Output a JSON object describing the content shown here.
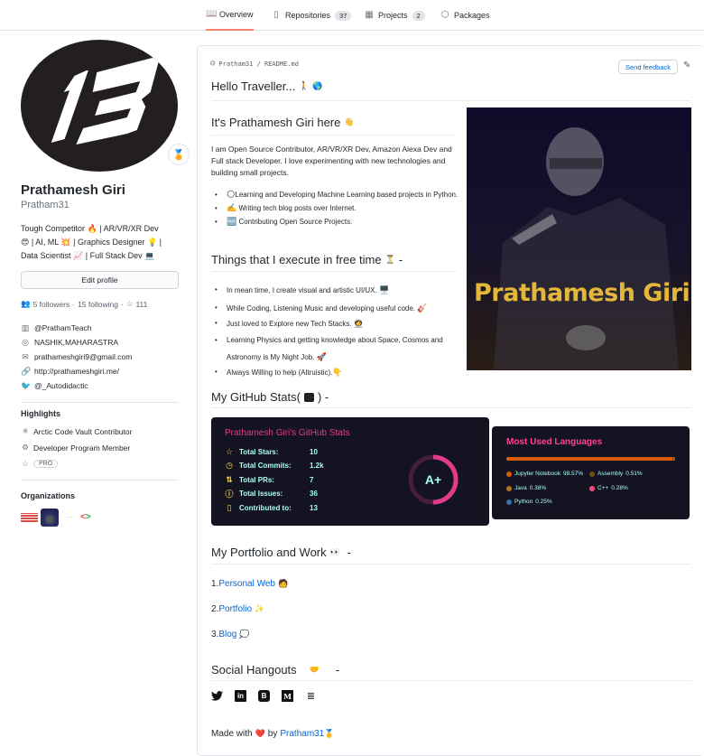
{
  "tabs": [
    {
      "label": "Overview",
      "icon": "book-icon",
      "active": true
    },
    {
      "label": "Repositories",
      "icon": "repo-icon",
      "count": "37"
    },
    {
      "label": "Projects",
      "icon": "project-icon",
      "count": "2"
    },
    {
      "label": "Packages",
      "icon": "package-icon"
    }
  ],
  "profile": {
    "full_name": "Prathamesh Giri",
    "login": "Pratham31",
    "avatar_text": "13",
    "bio_lines": [
      "Tough Competitor 🔥 | AR/VR/XR Dev",
      "😍 | AI, ML 💥 | Graphics Designer 💡 |",
      "Data Scientist 📈 | Full Stack Dev 💻"
    ],
    "edit_label": "Edit profile",
    "followers": "5 followers",
    "following": "15 following",
    "stars": "111",
    "dot": "·",
    "details": [
      {
        "icon": "organization-icon",
        "text": "@PrathamTeach"
      },
      {
        "icon": "location-icon",
        "text": "NASHIK,MAHARASTRA"
      },
      {
        "icon": "mail-icon",
        "text": "prathameshgiri9@gmail.com"
      },
      {
        "icon": "link-icon",
        "text": "http://prathameshgiri.me/"
      },
      {
        "icon": "twitter-icon",
        "text": "@_Autodidactic"
      }
    ],
    "highlights_title": "Highlights",
    "highlights": [
      {
        "icon": "arctic-vault-icon",
        "text": "Arctic Code Vault Contributor"
      },
      {
        "icon": "cpu-icon",
        "text": "Developer Program Member"
      },
      {
        "icon": "star-icon",
        "text": "PRO"
      }
    ],
    "organizations_title": "Organizations"
  },
  "readme": {
    "path": "Pratham31 / README.md",
    "feedback_label": "Send feedback",
    "greeting": "Hello Traveller...",
    "intro_heading": "It's Prathamesh Giri here",
    "intro_para": "I am Open Source Contributor, AR/VR/XR Dev, Amazon Alexa Dev and Full stack Developer. I love experimenting with new technologies and building small projects.",
    "intro_items": [
      {
        "emoji": "🌕",
        "text": "Learning and Developing Machine Learning based projects in Python."
      },
      {
        "emoji": "✍️",
        "text": " Writing tech blog posts over Internet."
      },
      {
        "emoji": "🆓",
        "text": " Contributing Open Source Projects."
      }
    ],
    "free_heading": "Things that I execute in free time",
    "free_items": [
      {
        "text": "In mean time, I create visual and artistic UI/UX.",
        "emoji": "🖥️"
      },
      {
        "text": "While Coding, Listening Music and developing useful code.",
        "emoji": "🎸"
      },
      {
        "text": "Just loved to Explore new Tech Stacks.",
        "emoji": "🧑‍🚀"
      },
      {
        "text": "Learning Physics and getting knowledge about Space, Cosmos and Astronomy is My Night Job.",
        "emoji": "🚀"
      },
      {
        "text": "Always Willing to help (Altruistic).",
        "emoji": "👇"
      }
    ],
    "hero_name": "Prathamesh Giri",
    "stats_heading": "My GitHub Stats(",
    "stats_heading_end": " ) -",
    "portfolio_heading": "My Portfolio and Work",
    "portfolio_links": [
      {
        "num": "1.",
        "label": "Personal Web",
        "emoji": "🧑"
      },
      {
        "num": "2.",
        "label": "Portfolio",
        "emoji": "✨"
      },
      {
        "num": "3.",
        "label": "Blog",
        "emoji": "💭"
      }
    ],
    "social_heading": "Social Hangouts",
    "socials": [
      {
        "name": "twitter",
        "glyph": "🐦"
      },
      {
        "name": "linkedin",
        "glyph": "in"
      },
      {
        "name": "blogger",
        "glyph": "B"
      },
      {
        "name": "medium",
        "glyph": "M"
      },
      {
        "name": "stackoverflow",
        "glyph": "≣"
      }
    ],
    "made_with": "Made with",
    "made_by": "by",
    "made_user": "Pratham31"
  },
  "github_stats": {
    "title": "Prathamesh Giri's GitHub Stats",
    "rows": [
      {
        "label": "Total Stars:",
        "value": "10",
        "icon": "star-icon"
      },
      {
        "label": "Total Commits:",
        "value": "1.2k",
        "icon": "clock-icon"
      },
      {
        "label": "Total PRs:",
        "value": "7",
        "icon": "pr-icon"
      },
      {
        "label": "Total Issues:",
        "value": "36",
        "icon": "issue-icon"
      },
      {
        "label": "Contributed to:",
        "value": "13",
        "icon": "repo-icon"
      }
    ],
    "rank": "A+",
    "rank_progress": 0.5,
    "colors": {
      "title": "#e03c8a",
      "text": "#a9fef7",
      "icon": "#f8d847",
      "bg": "#141321"
    }
  },
  "languages": {
    "title": "Most Used Languages",
    "items": [
      {
        "name": "Jupyter Notebook",
        "percent": 98.57,
        "label": "98.57%",
        "color": "#DA5B0B"
      },
      {
        "name": "Assembly",
        "percent": 0.51,
        "label": "0.51%",
        "color": "#6E4C13"
      },
      {
        "name": "Java",
        "percent": 0.38,
        "label": "0.38%",
        "color": "#b07219"
      },
      {
        "name": "C++",
        "percent": 0.28,
        "label": "0.28%",
        "color": "#f34b7d"
      },
      {
        "name": "Python",
        "percent": 0.25,
        "label": "0.25%",
        "color": "#3572A5"
      }
    ]
  }
}
